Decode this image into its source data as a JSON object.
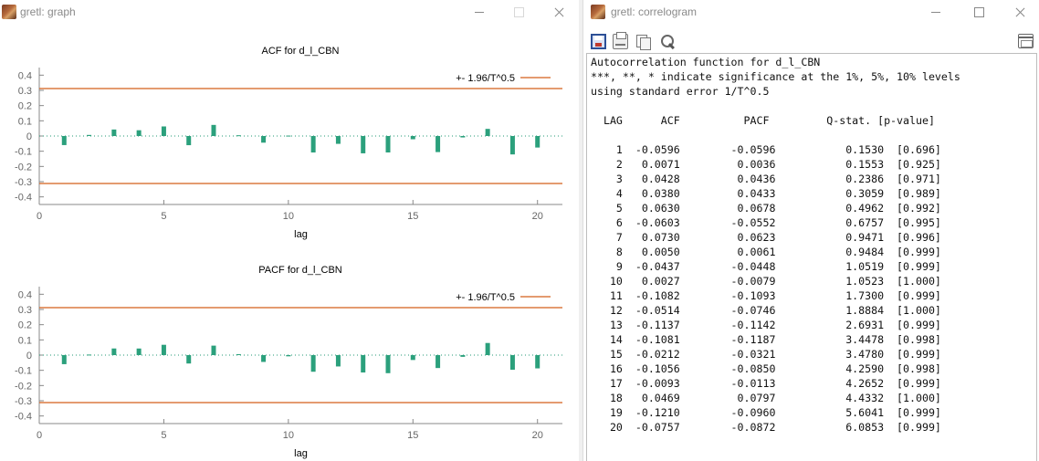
{
  "colors": {
    "bar": "#2ba07c",
    "conf_line": "#d45f1b",
    "zero_line": "#229a74",
    "axis": "#888888",
    "text_gray": "#666666",
    "title_text": "#8a8a8a"
  },
  "icons": {
    "app": "gretl-app-icon",
    "minimize": "minimize-icon",
    "maximize": "maximize-icon",
    "close": "close-icon",
    "save": "save-icon",
    "print": "print-icon",
    "copy": "copy-icon",
    "find": "find-icon",
    "main_window": "main-window-icon"
  },
  "graph_window": {
    "title": "gretl: graph"
  },
  "correlogram_window": {
    "title": "gretl: correlogram"
  },
  "chart_data": [
    {
      "type": "bar",
      "title": "ACF for d_l_CBN",
      "xlabel": "lag",
      "ylabel": "",
      "legend": "+- 1.96/T^0.5",
      "legend_position": "top-right",
      "band": 0.3122,
      "xlim": [
        0,
        21
      ],
      "ylim": [
        -0.45,
        0.45
      ],
      "xticks": [
        "0",
        "5",
        "10",
        "15",
        "20"
      ],
      "xtick_values": [
        0,
        5,
        10,
        15,
        20
      ],
      "yticks": [
        "0.4",
        "0.3",
        "0.2",
        "0.1",
        "0",
        "-0.1",
        "-0.2",
        "-0.3",
        "-0.4"
      ],
      "ytick_values": [
        0.4,
        0.3,
        0.2,
        0.1,
        0,
        -0.1,
        -0.2,
        -0.3,
        -0.4
      ],
      "x": [
        1,
        2,
        3,
        4,
        5,
        6,
        7,
        8,
        9,
        10,
        11,
        12,
        13,
        14,
        15,
        16,
        17,
        18,
        19,
        20
      ],
      "values": [
        -0.0596,
        0.0071,
        0.0428,
        0.038,
        0.063,
        -0.0603,
        0.073,
        0.005,
        -0.0437,
        0.0027,
        -0.1082,
        -0.0514,
        -0.1137,
        -0.1081,
        -0.0212,
        -0.1056,
        -0.0093,
        0.0469,
        -0.121,
        -0.0757
      ]
    },
    {
      "type": "bar",
      "title": "PACF for d_l_CBN",
      "xlabel": "lag",
      "ylabel": "",
      "legend": "+- 1.96/T^0.5",
      "legend_position": "top-right",
      "band": 0.3122,
      "xlim": [
        0,
        21
      ],
      "ylim": [
        -0.45,
        0.45
      ],
      "xticks": [
        "0",
        "5",
        "10",
        "15",
        "20"
      ],
      "xtick_values": [
        0,
        5,
        10,
        15,
        20
      ],
      "yticks": [
        "0.4",
        "0.3",
        "0.2",
        "0.1",
        "0",
        "-0.1",
        "-0.2",
        "-0.3",
        "-0.4"
      ],
      "ytick_values": [
        0.4,
        0.3,
        0.2,
        0.1,
        0,
        -0.1,
        -0.2,
        -0.3,
        -0.4
      ],
      "x": [
        1,
        2,
        3,
        4,
        5,
        6,
        7,
        8,
        9,
        10,
        11,
        12,
        13,
        14,
        15,
        16,
        17,
        18,
        19,
        20
      ],
      "values": [
        -0.0596,
        0.0036,
        0.0436,
        0.0433,
        0.0678,
        -0.0552,
        0.0623,
        0.0061,
        -0.0448,
        -0.0079,
        -0.1093,
        -0.0746,
        -0.1142,
        -0.1187,
        -0.0321,
        -0.085,
        -0.0113,
        0.0797,
        -0.096,
        -0.0872
      ]
    }
  ],
  "correlogram_text": {
    "header": [
      "Autocorrelation function for d_l_CBN",
      "***, **, * indicate significance at the 1%, 5%, 10% levels",
      "using standard error 1/T^0.5"
    ],
    "column_header": "  LAG      ACF          PACF         Q-stat. [p-value]",
    "rows": [
      "    1  -0.0596        -0.0596           0.1530  [0.696]",
      "    2   0.0071         0.0036           0.1553  [0.925]",
      "    3   0.0428         0.0436           0.2386  [0.971]",
      "    4   0.0380         0.0433           0.3059  [0.989]",
      "    5   0.0630         0.0678           0.4962  [0.992]",
      "    6  -0.0603        -0.0552           0.6757  [0.995]",
      "    7   0.0730         0.0623           0.9471  [0.996]",
      "    8   0.0050         0.0061           0.9484  [0.999]",
      "    9  -0.0437        -0.0448           1.0519  [0.999]",
      "   10   0.0027        -0.0079           1.0523  [1.000]",
      "   11  -0.1082        -0.1093           1.7300  [0.999]",
      "   12  -0.0514        -0.0746           1.8884  [1.000]",
      "   13  -0.1137        -0.1142           2.6931  [0.999]",
      "   14  -0.1081        -0.1187           3.4478  [0.998]",
      "   15  -0.0212        -0.0321           3.4780  [0.999]",
      "   16  -0.1056        -0.0850           4.2590  [0.998]",
      "   17  -0.0093        -0.0113           4.2652  [0.999]",
      "   18   0.0469         0.0797           4.4332  [1.000]",
      "   19  -0.1210        -0.0960           5.6041  [0.999]",
      "   20  -0.0757        -0.0872           6.0853  [0.999]"
    ]
  }
}
